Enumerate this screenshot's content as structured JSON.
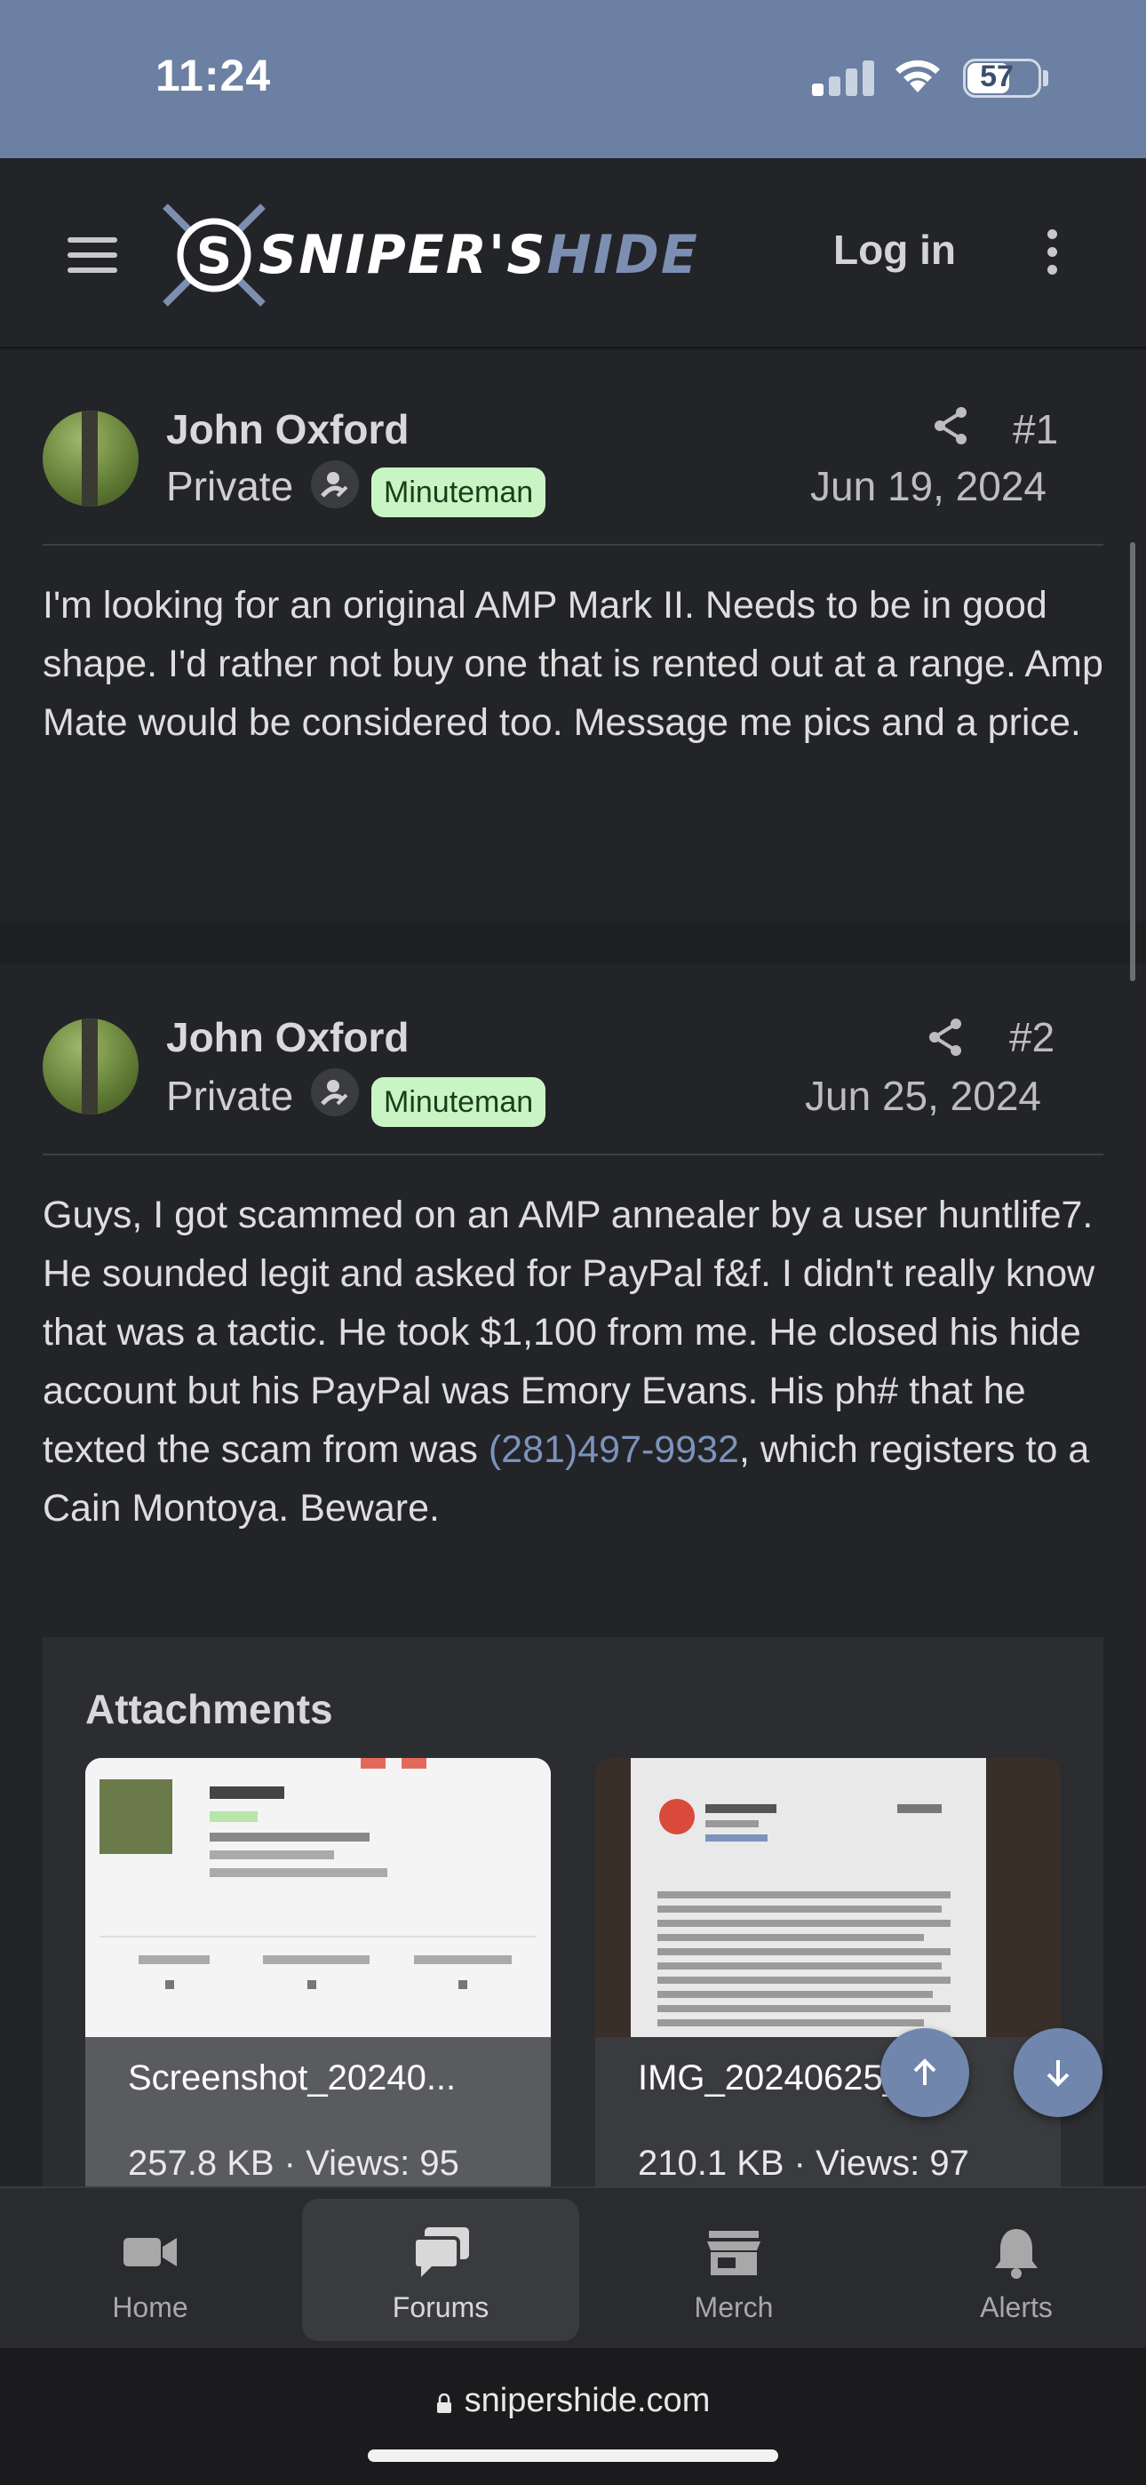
{
  "status_bar": {
    "time": "11:24",
    "battery": "57"
  },
  "header": {
    "logo_text_white": "SNIPER'S",
    "logo_text_blue": "HIDE",
    "login_label": "Log in"
  },
  "posts": [
    {
      "username": "John Oxford",
      "rank": "Private",
      "badge": "Minuteman",
      "number": "#1",
      "date": "Jun 19, 2024",
      "body": "I'm looking for an original AMP Mark II. Needs to be in good shape. I'd rather not buy one that is rented out at a range. Amp Mate would be considered too. Message me pics and a price."
    },
    {
      "username": "John Oxford",
      "rank": "Private",
      "badge": "Minuteman",
      "number": "#2",
      "date": "Jun 25, 2024",
      "body_before": "Guys, I got scammed on an AMP annealer by a user huntlife7. He sounded legit and asked for PayPal f&f. I didn't really know that was a tactic. He took $1,100 from me. He closed his hide account but his PayPal was Emory Evans. His ph# that he texted the scam from was ",
      "phone": "(281)497-9932",
      "body_after": ", which registers to a Cain Montoya. Beware."
    }
  ],
  "attachments": {
    "title": "Attachments",
    "items": [
      {
        "name": "Screenshot_20240...",
        "meta": "257.8 KB · Views: 95"
      },
      {
        "name": "IMG_20240625_1...",
        "meta": "210.1 KB · Views: 97"
      }
    ]
  },
  "tabbar": {
    "items": [
      {
        "label": "Home",
        "icon": "video-camera-icon"
      },
      {
        "label": "Forums",
        "icon": "chat-bubbles-icon"
      },
      {
        "label": "Merch",
        "icon": "store-icon"
      },
      {
        "label": "Alerts",
        "icon": "bell-icon"
      }
    ]
  },
  "browser": {
    "url": "snipershide.com"
  }
}
